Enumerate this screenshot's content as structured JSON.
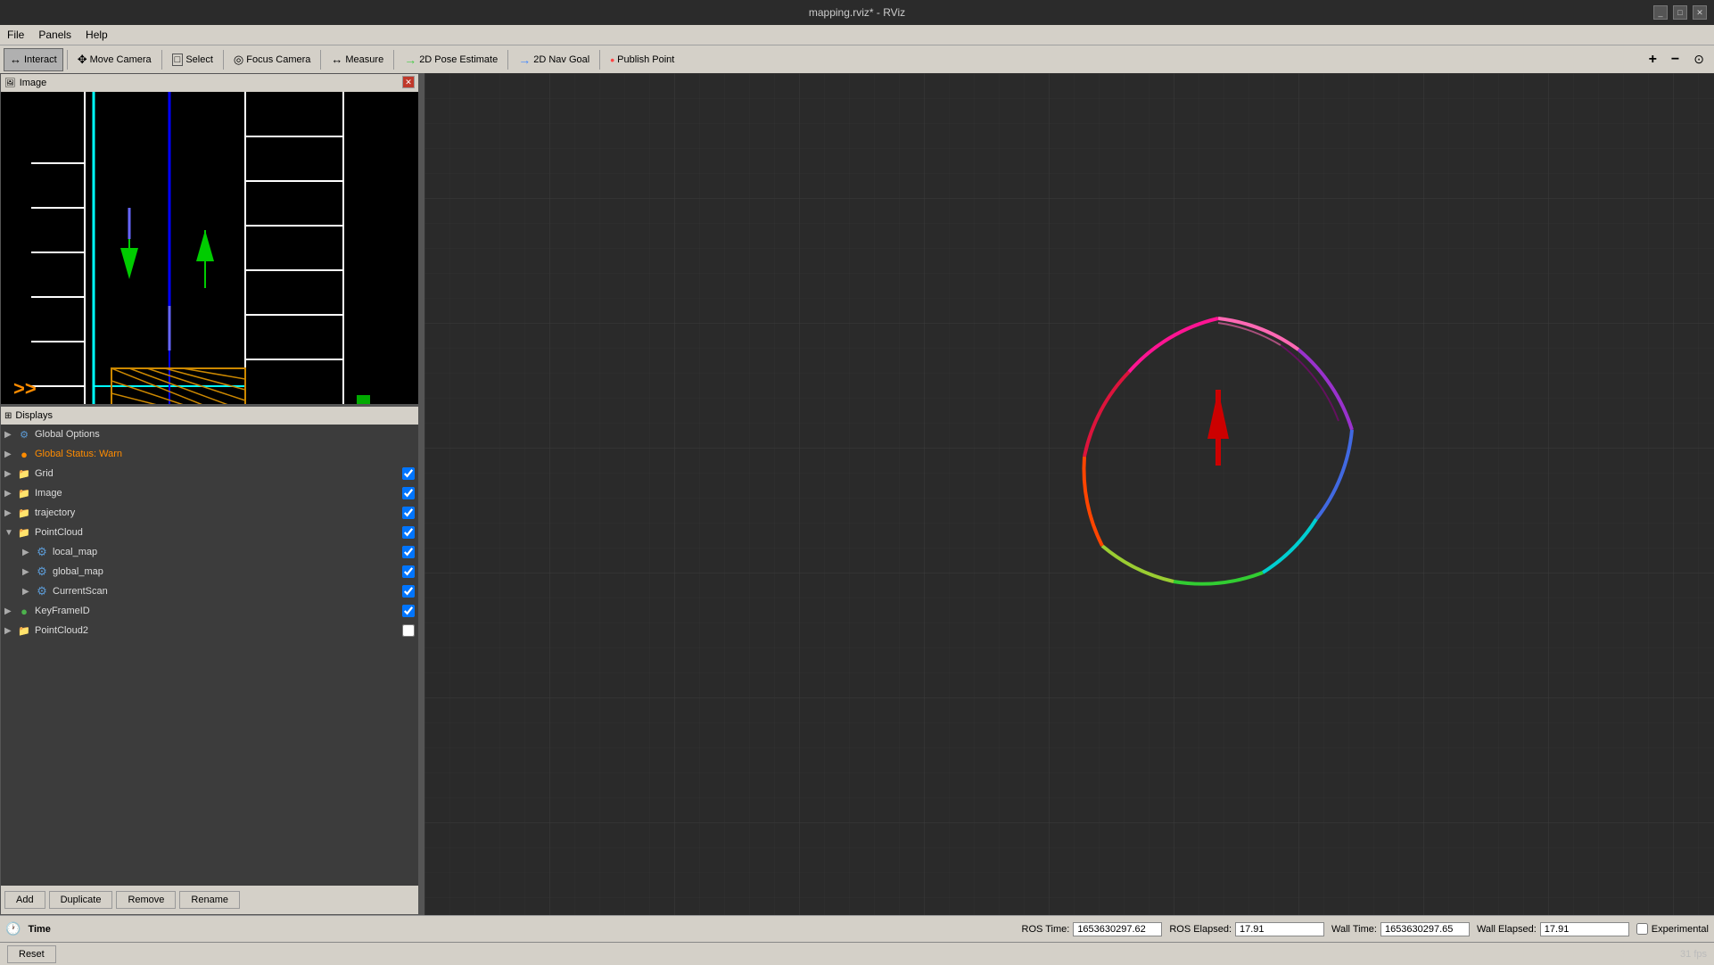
{
  "window": {
    "title": "mapping.rviz* - RViz"
  },
  "menubar": {
    "items": [
      "File",
      "Panels",
      "Help"
    ]
  },
  "toolbar": {
    "tools": [
      {
        "id": "interact",
        "label": "Interact",
        "icon": "interact-icon",
        "active": true
      },
      {
        "id": "move-camera",
        "label": "Move Camera",
        "icon": "move-icon",
        "active": false
      },
      {
        "id": "select",
        "label": "Select",
        "icon": "select-icon",
        "active": false
      },
      {
        "id": "focus-camera",
        "label": "Focus Camera",
        "icon": "focus-icon",
        "active": false
      },
      {
        "id": "measure",
        "label": "Measure",
        "icon": "measure-icon",
        "active": false
      },
      {
        "id": "2d-pose-estimate",
        "label": "2D Pose Estimate",
        "icon": "pose-icon",
        "active": false
      },
      {
        "id": "2d-nav-goal",
        "label": "2D Nav Goal",
        "icon": "nav-icon",
        "active": false
      },
      {
        "id": "publish-point",
        "label": "Publish Point",
        "icon": "point-icon",
        "active": false
      }
    ],
    "zoom_in": "+",
    "zoom_out": "−",
    "zoom_reset": "⊙"
  },
  "image_panel": {
    "title": "Image",
    "panel_icon": "image-panel-icon"
  },
  "displays_panel": {
    "title": "Displays",
    "items": [
      {
        "id": "global-options",
        "name": "Global Options",
        "level": 0,
        "icon": "gear",
        "color": "#5c9bd6",
        "has_checkbox": false,
        "checked": false,
        "expandable": true
      },
      {
        "id": "global-status",
        "name": "Global Status: Warn",
        "level": 0,
        "icon": "circle",
        "color": "#ff8c00",
        "has_checkbox": false,
        "checked": false,
        "expandable": true
      },
      {
        "id": "grid",
        "name": "Grid",
        "level": 0,
        "icon": "folder",
        "color": "#c8a000",
        "has_checkbox": true,
        "checked": true,
        "expandable": true
      },
      {
        "id": "image",
        "name": "Image",
        "level": 0,
        "icon": "folder",
        "color": "#c8a000",
        "has_checkbox": true,
        "checked": true,
        "expandable": true
      },
      {
        "id": "trajectory",
        "name": "trajectory",
        "level": 0,
        "icon": "folder",
        "color": "#c8a000",
        "has_checkbox": true,
        "checked": true,
        "expandable": true
      },
      {
        "id": "pointcloud",
        "name": "PointCloud",
        "level": 0,
        "icon": "folder",
        "color": "#c8a000",
        "has_checkbox": true,
        "checked": true,
        "expandable": true,
        "expanded": true
      },
      {
        "id": "local_map",
        "name": "local_map",
        "level": 1,
        "icon": "gear",
        "color": "#5c9bd6",
        "has_checkbox": true,
        "checked": true,
        "expandable": true
      },
      {
        "id": "global_map",
        "name": "global_map",
        "level": 1,
        "icon": "gear",
        "color": "#5c9bd6",
        "has_checkbox": true,
        "checked": true,
        "expandable": true
      },
      {
        "id": "currentscan",
        "name": "CurrentScan",
        "level": 1,
        "icon": "gear",
        "color": "#5c9bd6",
        "has_checkbox": true,
        "checked": true,
        "expandable": true
      },
      {
        "id": "keyframeid",
        "name": "KeyFrameID",
        "level": 0,
        "icon": "circle",
        "color": "#4db34d",
        "has_checkbox": true,
        "checked": true,
        "expandable": true
      },
      {
        "id": "pointcloud2",
        "name": "PointCloud2",
        "level": 0,
        "icon": "folder",
        "color": "#c8a000",
        "has_checkbox": true,
        "checked": false,
        "expandable": true
      }
    ],
    "buttons": [
      "Add",
      "Duplicate",
      "Remove",
      "Rename"
    ]
  },
  "time_panel": {
    "title": "Time",
    "fields": [
      {
        "label": "ROS Time:",
        "id": "ros-time",
        "value": "1653630297.62"
      },
      {
        "label": "ROS Elapsed:",
        "id": "ros-elapsed",
        "value": "17.91"
      },
      {
        "label": "Wall Time:",
        "id": "wall-time",
        "value": "1653630297.65"
      },
      {
        "label": "Wall Elapsed:",
        "id": "wall-elapsed",
        "value": "17.91"
      }
    ],
    "experimental_label": "Experimental"
  },
  "statusbar": {
    "reset_label": "Reset",
    "fps": "31 fps"
  },
  "colors": {
    "background_grid": "#2a2a2a",
    "grid_line": "#3d3d3d",
    "toolbar_bg": "#d4d0c8",
    "panel_bg": "#3c3c3c"
  }
}
